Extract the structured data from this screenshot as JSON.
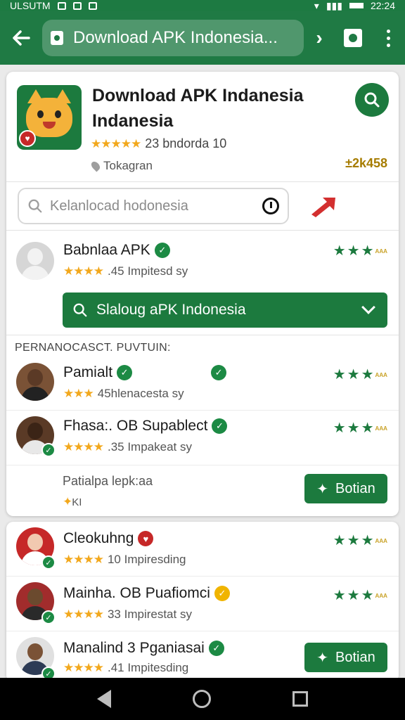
{
  "status_bar": {
    "left_text": "ULSUTM",
    "time": "22:24"
  },
  "browser": {
    "url_title": "Download APK Indonesia..."
  },
  "app": {
    "title": "Download APK Indanesia Indanesia",
    "rating_text": "23 bndorda 10",
    "location": "Tokagran",
    "downloads": "±2k458"
  },
  "search": {
    "placeholder": "Kelanlocad hodonesia"
  },
  "top_member": {
    "name": "Babnlaa APK",
    "meta": ".45 Impitesd sy"
  },
  "dropdown": {
    "label": "Slaloug aPK Indonesia"
  },
  "section_label": "PERNANOCASCT. PUVTUIN:",
  "members": [
    {
      "name": "Pamialt",
      "meta": "45hlenacesta sy"
    },
    {
      "name": "Fhasa:. OB Supablect",
      "meta": ".35 Impakeat sy"
    }
  ],
  "footer": {
    "title": "Patialpa lepk:aa",
    "sub": "KI",
    "button": "Botian"
  },
  "members2": [
    {
      "name": "Cleokuhng",
      "meta": "10 Impiresding"
    },
    {
      "name": "Mainha. OB Puafiomci",
      "meta": "33 Impirestat sy"
    },
    {
      "name": "Manalind 3 Pganiasai",
      "meta": ".41 Impitesding"
    }
  ],
  "bottom_button": "Botian",
  "colors": {
    "brand_green": "#1c7a3e",
    "star_gold": "#f2a81d",
    "badge_red": "#c62828"
  }
}
